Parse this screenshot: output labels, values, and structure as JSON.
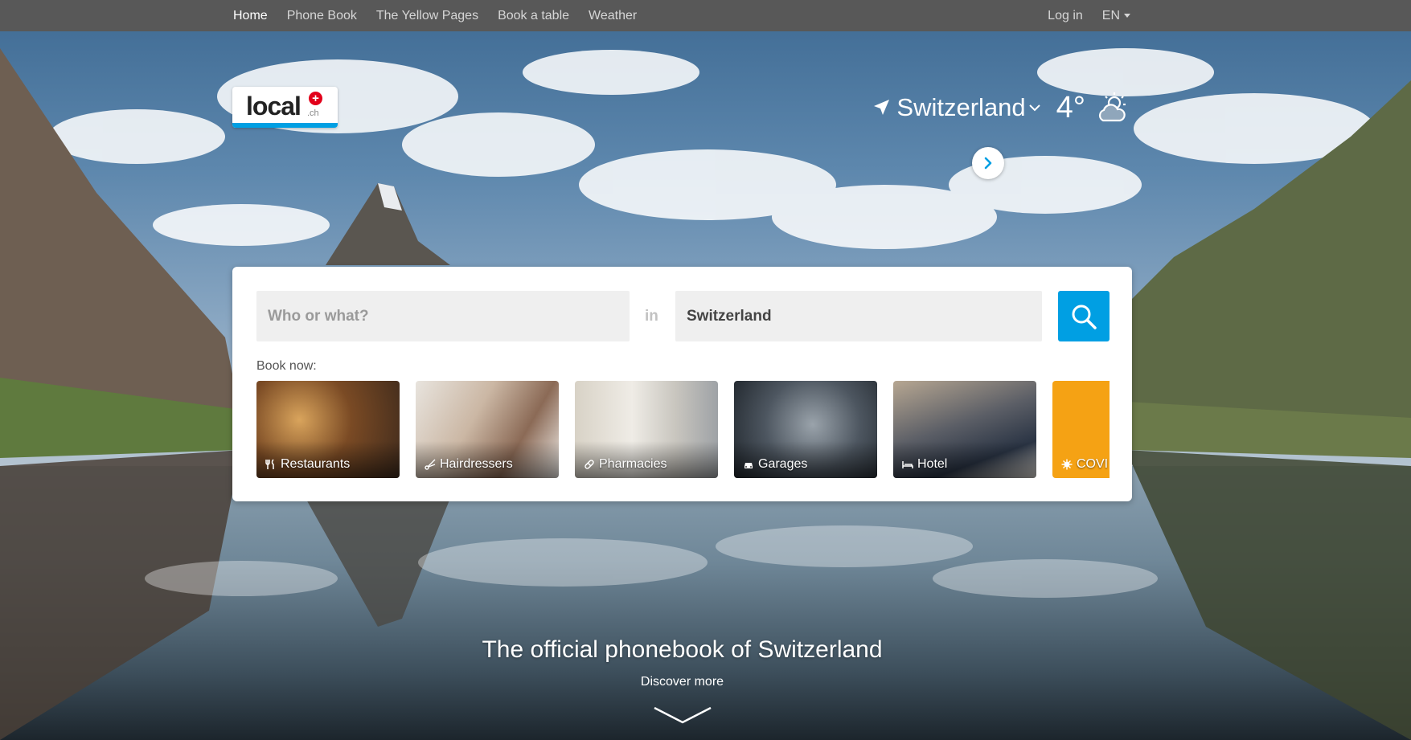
{
  "nav": {
    "items": [
      {
        "label": "Home",
        "active": true
      },
      {
        "label": "Phone Book"
      },
      {
        "label": "The Yellow Pages"
      },
      {
        "label": "Book a table"
      },
      {
        "label": "Weather"
      }
    ],
    "login_label": "Log in",
    "language_label": "EN"
  },
  "logo": {
    "word": "local",
    "suffix": ".ch",
    "plus": "+"
  },
  "location": {
    "name": "Switzerland",
    "icon": "location-arrow-icon"
  },
  "weather": {
    "temperature": "4°",
    "icon": "partly-cloudy-icon"
  },
  "search": {
    "what_placeholder": "Who or what?",
    "in_label": "in",
    "where_value": "Switzerland",
    "button_icon": "search-icon"
  },
  "book_now": {
    "label": "Book now:",
    "categories": [
      {
        "label": "Restaurants",
        "icon": "fork-knife-icon"
      },
      {
        "label": "Hairdressers",
        "icon": "scissors-icon"
      },
      {
        "label": "Pharmacies",
        "icon": "pill-icon"
      },
      {
        "label": "Garages",
        "icon": "car-icon"
      },
      {
        "label": "Hotel",
        "icon": "bed-icon"
      },
      {
        "label": "COVI",
        "icon": "virus-icon"
      }
    ]
  },
  "hero": {
    "tagline": "The official phonebook of Switzerland",
    "discover_label": "Discover more"
  },
  "colors": {
    "brand_blue": "#009fe3",
    "brand_red": "#e2001a",
    "nav_bg": "#585858",
    "covid_tile": "#f5a214"
  }
}
